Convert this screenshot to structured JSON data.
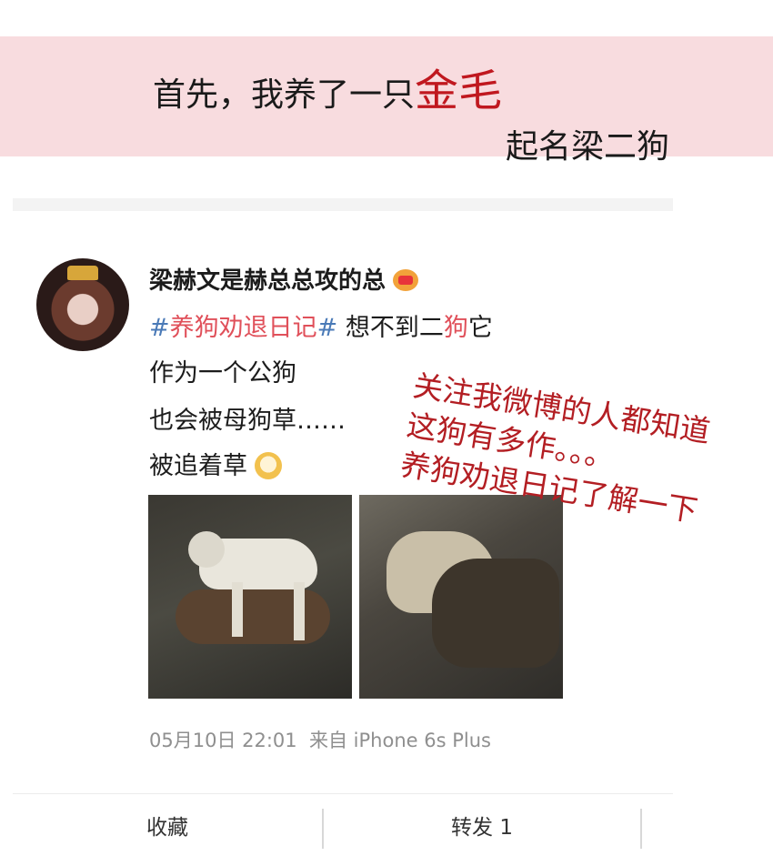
{
  "caption": {
    "line1_before": "首先，我养了一只",
    "line1_highlight": "金毛",
    "line2": "起名梁二狗"
  },
  "post": {
    "username": "梁赫文是赫总总攻的总",
    "topic_prefix": "#",
    "topic_text": "养狗劝退日记",
    "topic_suffix": "#",
    "line1_after_topic": " 想不到二",
    "line1_red": "狗",
    "line1_end": "它",
    "line2": "作为一个公狗",
    "line3": "也会被母狗草……",
    "line4": "被追着草",
    "timestamp": "05月10日 22:01",
    "source": "来自 iPhone 6s Plus"
  },
  "actions": {
    "favorite": "收藏",
    "forward": "转发 1"
  },
  "overlay": {
    "line1": "关注我微博的人都知道",
    "line2": "这狗有多作。。。",
    "line3": "养狗劝退日记了解一下"
  },
  "colors": {
    "band": "#f8dcdf",
    "highlight_red": "#c0181f",
    "topic_blue": "#4a7ab7",
    "overlay_red": "#b31e23"
  },
  "icons": [
    "crown-badge-icon",
    "dog-emoji-icon"
  ]
}
